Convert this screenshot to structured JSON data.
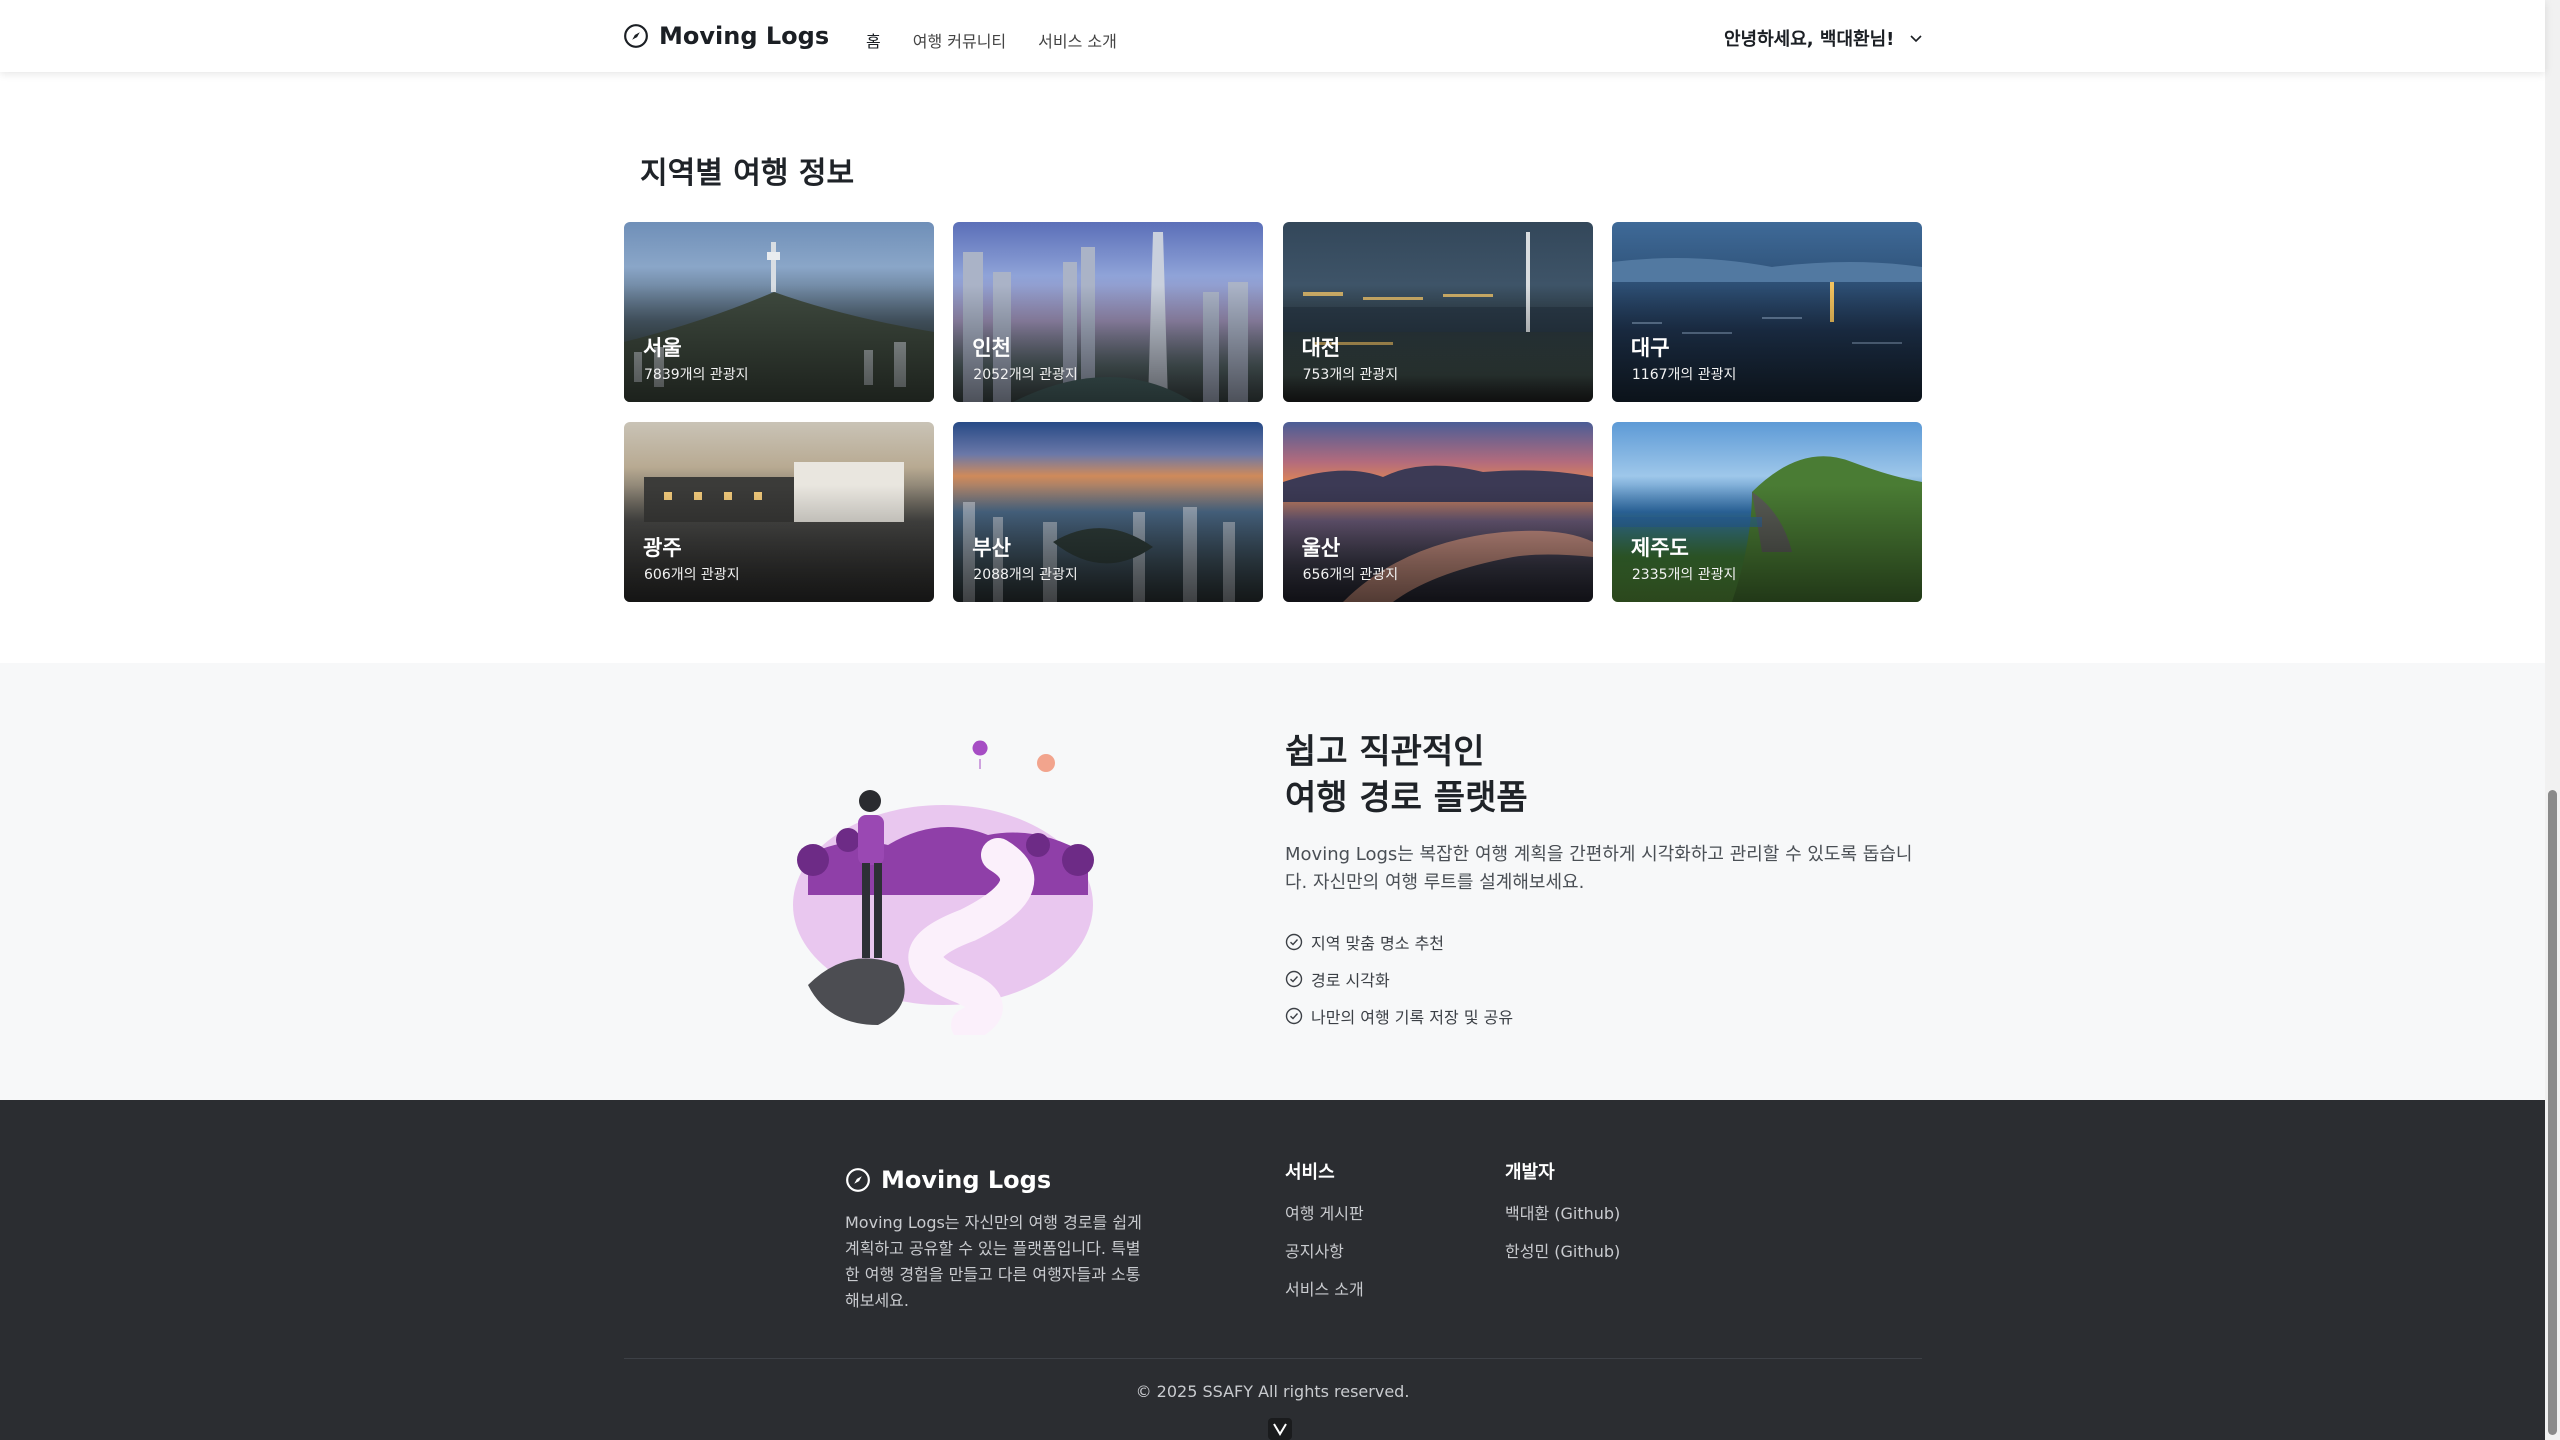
{
  "header": {
    "brand": "Moving Logs",
    "nav": [
      {
        "label": "홈"
      },
      {
        "label": "여행 커뮤니티"
      },
      {
        "label": "서비스 소개"
      }
    ],
    "greeting": "안녕하세요, 백대환님!"
  },
  "regions": {
    "title": "지역별 여행 정보",
    "cards": [
      {
        "name": "서울",
        "count": "7839개의 관광지"
      },
      {
        "name": "인천",
        "count": "2052개의 관광지"
      },
      {
        "name": "대전",
        "count": "753개의 관광지"
      },
      {
        "name": "대구",
        "count": "1167개의 관광지"
      },
      {
        "name": "광주",
        "count": "606개의 관광지"
      },
      {
        "name": "부산",
        "count": "2088개의 관광지"
      },
      {
        "name": "울산",
        "count": "656개의 관광지"
      },
      {
        "name": "제주도",
        "count": "2335개의 관광지"
      }
    ]
  },
  "feature": {
    "title_line1": "쉽고 직관적인",
    "title_line2": "여행 경로 플랫폼",
    "description": "Moving Logs는 복잡한 여행 계획을 간편하게 시각화하고 관리할 수 있도록 돕습니다. 자신만의 여행 루트를 설계해보세요.",
    "items": [
      "지역 맞춤 명소 추천",
      "경로 시각화",
      "나만의 여행 기록 저장 및 공유"
    ]
  },
  "footer": {
    "brand": "Moving Logs",
    "description": "Moving Logs는 자신만의 여행 경로를 쉽게 계획하고 공유할 수 있는 플랫폼입니다. 특별한 여행 경험을 만들고 다른 여행자들과 소통해보세요.",
    "services": {
      "title": "서비스",
      "links": [
        "여행 게시판",
        "공지사항",
        "서비스 소개"
      ]
    },
    "developers": {
      "title": "개발자",
      "links": [
        "백대환 (Github)",
        "한성민 (Github)"
      ]
    },
    "copyright": "© 2025 SSAFY All rights reserved."
  },
  "colors": {
    "footer_bg": "#2b2d31",
    "feature_bg": "#f7f8f9",
    "illustration_accent": "#b56cc9"
  },
  "icons": [
    "compass-icon",
    "chevron-down-icon",
    "check-circle-icon"
  ]
}
